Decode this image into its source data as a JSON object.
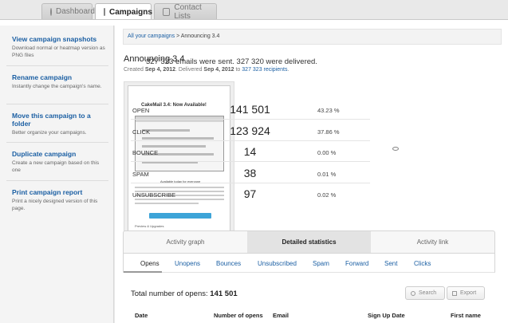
{
  "tabs": [
    {
      "label": "Dashboard",
      "icon": "dashboard-icon"
    },
    {
      "label": "Campaigns",
      "icon": "envelope-icon"
    },
    {
      "label": "Contact Lists",
      "icon": "contacts-icon"
    }
  ],
  "sidebar": {
    "items": [
      {
        "title": "View campaign snapshots",
        "desc": "Download normal or heatmap version as PNG files"
      },
      {
        "title": "Rename campaign",
        "desc": "Instantly change the campaign's name."
      },
      {
        "title": "Move this campaign to a folder",
        "desc": "Better organize your campaigns."
      },
      {
        "title": "Duplicate campaign",
        "desc": "Create a new campaign based on this one"
      },
      {
        "title": "Print campaign report",
        "desc": "Print a nicely designed version of this page."
      }
    ]
  },
  "breadcrumb": {
    "link": "All your campaigns",
    "sep": " > ",
    "current": "Announcing 3.4"
  },
  "campaign": {
    "title": "Announcing 3.4",
    "created_label": "Created ",
    "created_date": "Sep 4, 2012",
    "delivered_label": ". Delivered ",
    "delivered_date": "Sep 4, 2012",
    "to_label": " to ",
    "recipients": "327 323 recipients",
    "end": "."
  },
  "preview": {
    "heading": "CakeMail 3.4: Now Available!",
    "subheading": "Available today for everyone",
    "footer": "Preview & Upgrades"
  },
  "summary": "327 323 emails were sent. 327 320 were delivered.",
  "stats": [
    {
      "label": "OPEN",
      "value": "141 501",
      "pct": "43.23 %"
    },
    {
      "label": "CLICK",
      "value": "123 924",
      "pct": "37.86 %"
    },
    {
      "label": "BOUNCE",
      "value": "14",
      "pct": "0.00 %"
    },
    {
      "label": "SPAM",
      "value": "38",
      "pct": "0.01 %"
    },
    {
      "label": "UNSUBSCRIBE",
      "value": "97",
      "pct": "0.02 %"
    }
  ],
  "report_tabs": [
    "Activity graph",
    "Detailed statistics",
    "Activity link"
  ],
  "sub_tabs": [
    "Opens",
    "Unopens",
    "Bounces",
    "Unsubscribed",
    "Spam",
    "Forward",
    "Sent",
    "Clicks"
  ],
  "opens": {
    "label": "Total number of opens: ",
    "value": "141 501"
  },
  "buttons": {
    "search": "Search",
    "export": "Export"
  },
  "columns": [
    "Date",
    "Number of opens",
    "Email",
    "Sign Up Date",
    "First name"
  ]
}
